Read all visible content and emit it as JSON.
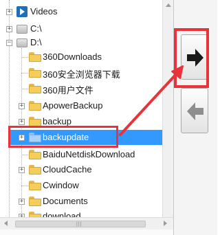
{
  "tree": {
    "items": [
      {
        "label": "Videos"
      },
      {
        "label": "C:\\"
      },
      {
        "label": "D:\\"
      },
      {
        "label": "360Downloads"
      },
      {
        "label": "360安全浏览器下载"
      },
      {
        "label": "360用户文件"
      },
      {
        "label": "ApowerBackup"
      },
      {
        "label": "backup"
      },
      {
        "label": "backupdate"
      },
      {
        "label": "BaiduNetdiskDownload"
      },
      {
        "label": "CloudCache"
      },
      {
        "label": "Cwindow"
      },
      {
        "label": "Documents"
      },
      {
        "label": "download"
      }
    ],
    "selected_label": "backupdate",
    "highlight_color": "#e8333a",
    "selection_color": "#3399ff"
  },
  "buttons": {
    "move_right": {
      "icon": "arrow-right-icon"
    },
    "move_left": {
      "icon": "arrow-left-icon"
    }
  }
}
